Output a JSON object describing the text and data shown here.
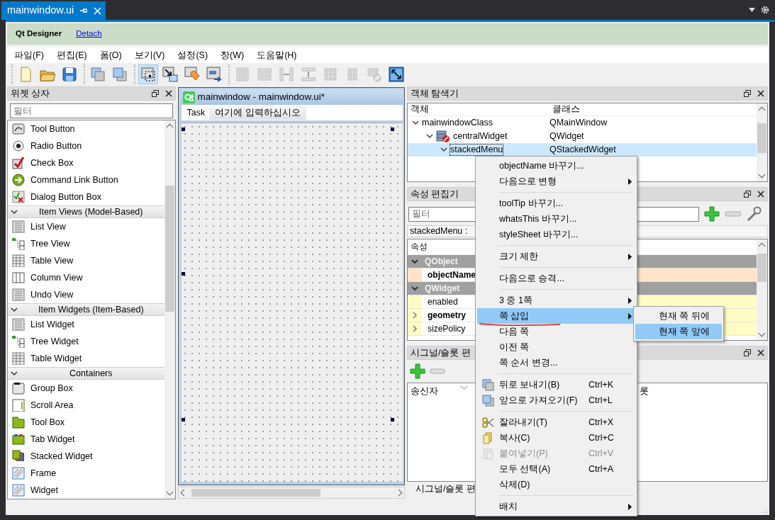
{
  "document_tab": {
    "title": "mainwindow.ui"
  },
  "banner": {
    "title": "Qt Designer",
    "link": "Detach"
  },
  "menu_bar": [
    "파일(F)",
    "편집(E)",
    "폼(O)",
    "보기(V)",
    "설정(S)",
    "창(W)",
    "도움말(H)"
  ],
  "toolbar": {
    "groups": [
      {
        "buttons": [
          {
            "selected": false,
            "disabled": false
          },
          {
            "selected": false,
            "disabled": false
          },
          {
            "selected": false,
            "disabled": false
          }
        ]
      },
      {
        "buttons": [
          {
            "selected": false,
            "disabled": false
          },
          {
            "selected": false,
            "disabled": false
          }
        ]
      },
      {
        "buttons": [
          {
            "selected": true,
            "disabled": false
          },
          {
            "selected": false,
            "disabled": false
          },
          {
            "selected": false,
            "disabled": false
          },
          {
            "selected": false,
            "disabled": false
          }
        ]
      },
      {
        "buttons": [
          {
            "selected": false,
            "disabled": true
          },
          {
            "selected": false,
            "disabled": true
          },
          {
            "selected": false,
            "disabled": true
          },
          {
            "selected": false,
            "disabled": true
          },
          {
            "selected": false,
            "disabled": true
          },
          {
            "selected": false,
            "disabled": true
          },
          {
            "selected": false,
            "disabled": true
          },
          {
            "selected": false,
            "disabled": false
          }
        ]
      }
    ]
  },
  "widget_box": {
    "title": "위젯 상자",
    "filter_placeholder": "필터",
    "items": [
      {
        "kind": "widget",
        "label": "Tool Button"
      },
      {
        "kind": "widget",
        "label": "Radio Button"
      },
      {
        "kind": "widget",
        "label": "Check Box"
      },
      {
        "kind": "widget",
        "label": "Command Link Button"
      },
      {
        "kind": "widget",
        "label": "Dialog Button Box"
      },
      {
        "kind": "category",
        "label": "Item Views (Model-Based)",
        "expanded": true,
        "children": [
          {
            "kind": "widget",
            "label": "List View"
          },
          {
            "kind": "widget",
            "label": "Tree View"
          },
          {
            "kind": "widget",
            "label": "Table View"
          },
          {
            "kind": "widget",
            "label": "Column View"
          },
          {
            "kind": "widget",
            "label": "Undo View"
          }
        ]
      },
      {
        "kind": "category",
        "label": "Item Widgets (Item-Based)",
        "expanded": true,
        "children": [
          {
            "kind": "widget",
            "label": "List Widget"
          },
          {
            "kind": "widget",
            "label": "Tree Widget"
          },
          {
            "kind": "widget",
            "label": "Table Widget"
          }
        ]
      },
      {
        "kind": "category",
        "label": "Containers",
        "expanded": true,
        "children": [
          {
            "kind": "widget",
            "label": "Group Box"
          },
          {
            "kind": "widget",
            "label": "Scroll Area"
          },
          {
            "kind": "widget",
            "label": "Tool Box"
          },
          {
            "kind": "widget",
            "label": "Tab Widget"
          },
          {
            "kind": "widget",
            "label": "Stacked Widget"
          },
          {
            "kind": "widget",
            "label": "Frame"
          },
          {
            "kind": "widget",
            "label": "Widget"
          }
        ]
      }
    ]
  },
  "form_window": {
    "title": "mainwindow - mainwindow.ui*",
    "menu": [
      {
        "kind": "menu",
        "label": "Task"
      },
      {
        "kind": "placeholder",
        "label": "여기에 입력하십시오"
      }
    ]
  },
  "object_inspector": {
    "title": "객체 탐색기",
    "columns": [
      "객체",
      "클래스"
    ],
    "rows": [
      {
        "name": "mainwindowClass",
        "class": "QMainWindow",
        "widget_icon": false,
        "expanded": true,
        "selected": false,
        "children": [
          {
            "name": "centralWidget",
            "class": "QWidget",
            "widget_icon": true,
            "expanded": true,
            "selected": false,
            "children": [
              {
                "name": "stackedMenu",
                "class": "QStackedWidget",
                "widget_icon": false,
                "expanded": true,
                "selected": true
              }
            ]
          }
        ]
      }
    ]
  },
  "property_editor": {
    "title": "속성 편집기",
    "filter_placeholder": "필터",
    "object_label": "stackedMenu :",
    "column": "속성",
    "groups": [
      {
        "name": "QObject",
        "color": "#ffe4c8",
        "expanded": true,
        "properties": [
          {
            "name": "objectName",
            "changed": true,
            "kind": "simple"
          }
        ]
      },
      {
        "name": "QWidget",
        "color": "#fffcc4",
        "expanded": true,
        "properties": [
          {
            "name": "enabled",
            "changed": false,
            "kind": "simple"
          },
          {
            "name": "geometry",
            "changed": true,
            "kind": "compound"
          },
          {
            "name": "sizePolicy",
            "changed": false,
            "kind": "compound"
          }
        ]
      }
    ]
  },
  "signal_slot_editor": {
    "title": "시그널/슬롯 편",
    "columns": [
      "송신자",
      "롯"
    ],
    "tab": "시그널/슬롯 편"
  },
  "context_menu": {
    "items": [
      {
        "kind": "action",
        "label": "objectName 바꾸기...",
        "submenu": false,
        "disabled": false,
        "selected": false
      },
      {
        "kind": "action",
        "label": "다음으로 변형",
        "submenu": true,
        "disabled": false,
        "selected": false
      },
      {
        "kind": "separator"
      },
      {
        "kind": "action",
        "label": "toolTip 바꾸기...",
        "submenu": false,
        "disabled": false,
        "selected": false
      },
      {
        "kind": "action",
        "label": "whatsThis 바꾸기...",
        "submenu": false,
        "disabled": false,
        "selected": false
      },
      {
        "kind": "action",
        "label": "styleSheet 바꾸기...",
        "submenu": false,
        "disabled": false,
        "selected": false
      },
      {
        "kind": "separator"
      },
      {
        "kind": "action",
        "label": "크기 제한",
        "submenu": true,
        "disabled": false,
        "selected": false
      },
      {
        "kind": "separator"
      },
      {
        "kind": "action",
        "label": "다음으로 승격...",
        "submenu": false,
        "disabled": false,
        "selected": false
      },
      {
        "kind": "separator"
      },
      {
        "kind": "action",
        "label": "3 중 1쪽",
        "submenu": true,
        "disabled": false,
        "selected": false
      },
      {
        "kind": "action",
        "label": "쪽 삽입",
        "submenu": true,
        "disabled": false,
        "selected": true
      },
      {
        "kind": "action",
        "label": "다음 쪽",
        "submenu": false,
        "disabled": false,
        "selected": false
      },
      {
        "kind": "action",
        "label": "이전 쪽",
        "submenu": false,
        "disabled": false,
        "selected": false
      },
      {
        "kind": "action",
        "label": "쪽 순서 변경...",
        "submenu": false,
        "disabled": false,
        "selected": false
      },
      {
        "kind": "separator"
      },
      {
        "kind": "action",
        "label": "뒤로 보내기(B)",
        "shortcut": "Ctrl+K",
        "submenu": false,
        "disabled": false,
        "selected": false
      },
      {
        "kind": "action",
        "label": "앞으로 가져오기(F)",
        "shortcut": "Ctrl+L",
        "submenu": false,
        "disabled": false,
        "selected": false
      },
      {
        "kind": "separator"
      },
      {
        "kind": "action",
        "label": "잘라내기(T)",
        "shortcut": "Ctrl+X",
        "submenu": false,
        "disabled": false,
        "selected": false
      },
      {
        "kind": "action",
        "label": "복사(C)",
        "shortcut": "Ctrl+C",
        "submenu": false,
        "disabled": false,
        "selected": false
      },
      {
        "kind": "action",
        "label": "붙여넣기(P)",
        "shortcut": "Ctrl+V",
        "submenu": false,
        "disabled": true,
        "selected": false
      },
      {
        "kind": "action",
        "label": "모두 선택(A)",
        "shortcut": "Ctrl+A",
        "submenu": false,
        "disabled": false,
        "selected": false
      },
      {
        "kind": "action",
        "label": "삭제(D)",
        "submenu": false,
        "disabled": false,
        "selected": false
      },
      {
        "kind": "separator"
      },
      {
        "kind": "action",
        "label": "배치",
        "submenu": true,
        "disabled": false,
        "selected": false
      }
    ]
  },
  "submenu": {
    "items": [
      {
        "label": "현재 쪽 뒤에",
        "selected": false
      },
      {
        "label": "현재 쪽 앞에",
        "selected": true
      }
    ]
  }
}
